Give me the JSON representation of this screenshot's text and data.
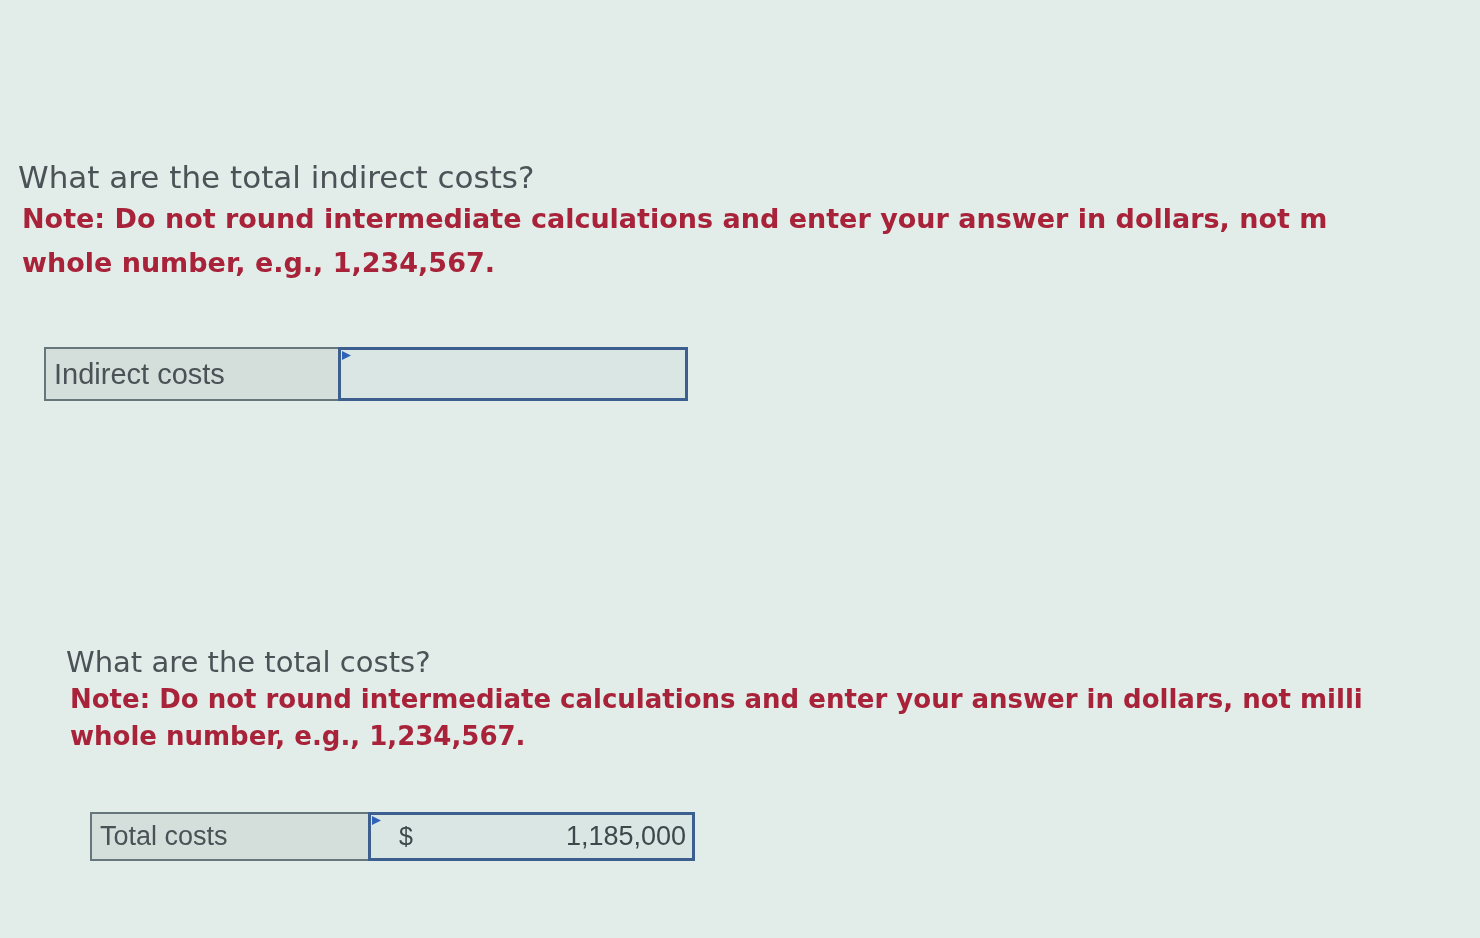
{
  "questions": [
    {
      "prompt": "What are the total indirect costs?",
      "note_lines": [
        "Note: Do not round intermediate calculations and enter your answer in dollars, not m",
        "whole number, e.g., 1,234,567."
      ],
      "answer": {
        "label": "Indirect costs"
      }
    },
    {
      "prompt": "What are the total costs?",
      "note_lines": [
        "Note: Do not round intermediate calculations and enter your answer in dollars, not milli",
        "whole number, e.g., 1,234,567."
      ],
      "answer": {
        "label": "Total costs",
        "prefix": "$",
        "value": "1,185,000"
      }
    }
  ]
}
